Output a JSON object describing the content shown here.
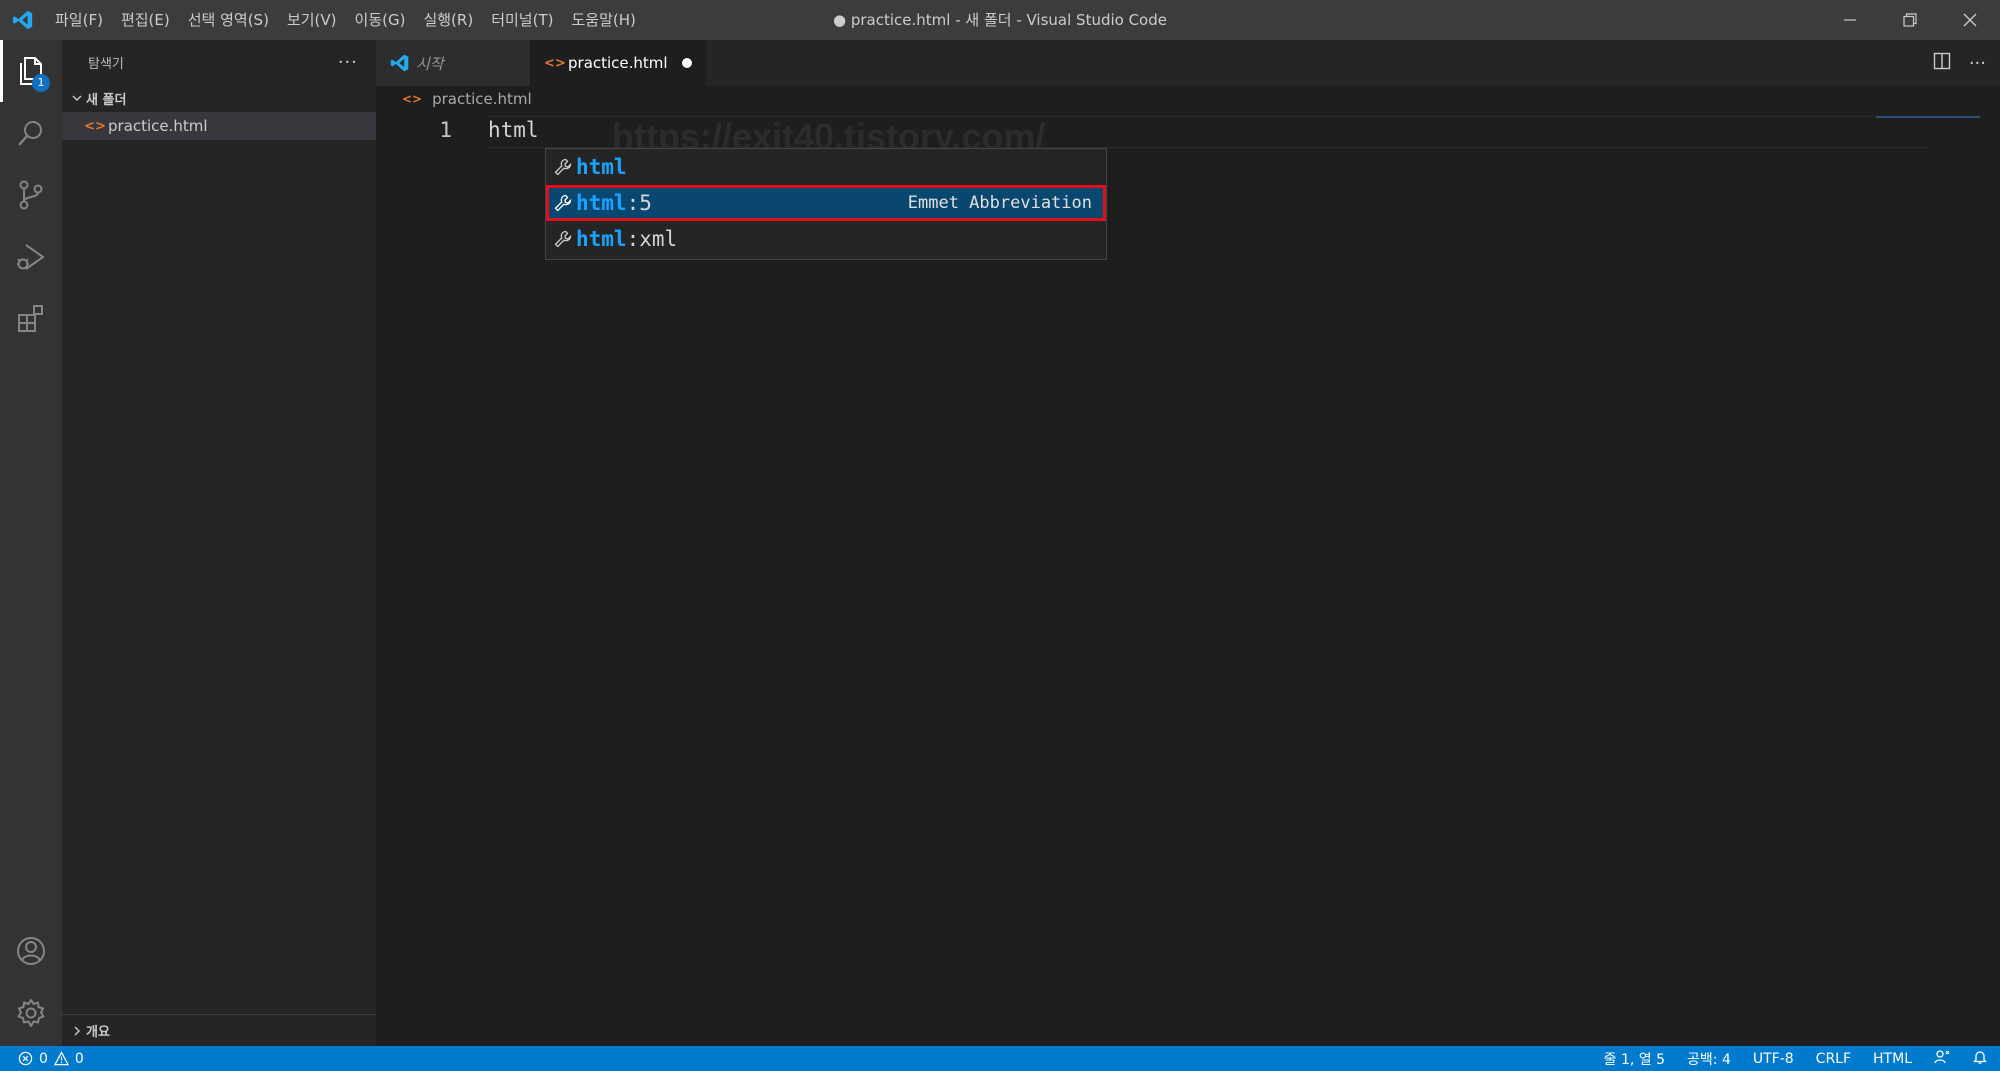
{
  "window": {
    "title": "● practice.html - 새 폴더 - Visual Studio Code",
    "menus": [
      "파일(F)",
      "편집(E)",
      "선택 영역(S)",
      "보기(V)",
      "이동(G)",
      "실행(R)",
      "터미널(T)",
      "도움말(H)"
    ]
  },
  "activity": {
    "explorer_badge": "1"
  },
  "sidebar": {
    "title": "탐색기",
    "more": "···",
    "folder": "새 폴더",
    "file": "practice.html",
    "outline": "개요"
  },
  "tabs": {
    "start_label": "시작",
    "practice_label": "practice.html",
    "file_icon": "<>"
  },
  "breadcrumb": {
    "file": "practice.html",
    "file_icon": "<>"
  },
  "editor": {
    "line_number": "1",
    "code": "html",
    "watermark": "https://exit40.tistory.com/"
  },
  "suggest": {
    "items": [
      {
        "match": "html",
        "rest": "",
        "detail": ""
      },
      {
        "match": "html",
        "rest": ":5",
        "detail": "Emmet Abbreviation"
      },
      {
        "match": "html",
        "rest": ":xml",
        "detail": ""
      }
    ]
  },
  "status": {
    "errors": "0",
    "warnings": "0",
    "position": "줄 1, 열 5",
    "spaces": "공백: 4",
    "encoding": "UTF-8",
    "eol": "CRLF",
    "language": "HTML"
  },
  "colors": {
    "accent": "#007acc",
    "selection": "#094771",
    "highlight_border": "#e0101b",
    "match": "#18a3ff"
  }
}
